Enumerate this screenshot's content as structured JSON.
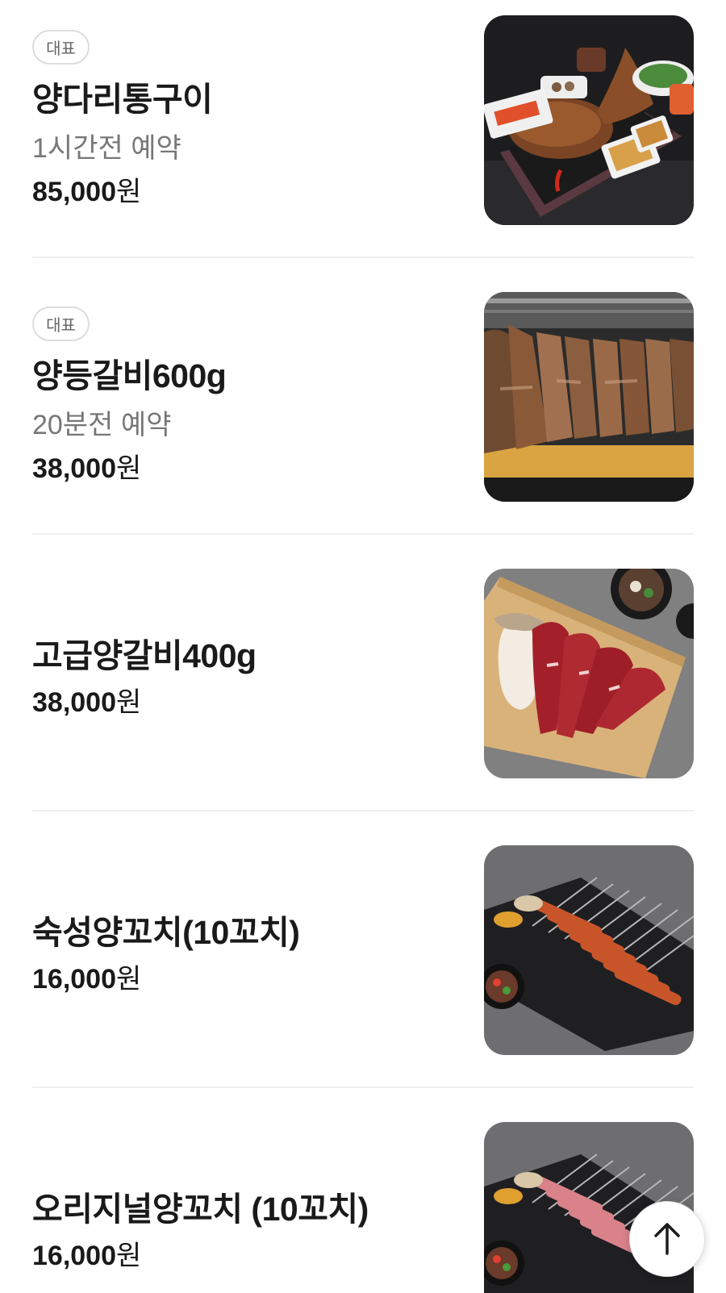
{
  "menu": {
    "items": [
      {
        "badge": "대표",
        "name": "양다리통구이",
        "note": "1시간전 예약",
        "price_num": "85,000",
        "price_unit": "원",
        "image_icon": "lamb-leg-roast-photo"
      },
      {
        "badge": "대표",
        "name": "양등갈비600g",
        "note": "20분전 예약",
        "price_num": "38,000",
        "price_unit": "원",
        "image_icon": "lamb-back-ribs-photo"
      },
      {
        "name": "고급양갈비400g",
        "price_num": "38,000",
        "price_unit": "원",
        "image_icon": "raw-lamb-ribs-photo"
      },
      {
        "name": "숙성양꼬치(10꼬치)",
        "price_num": "16,000",
        "price_unit": "원",
        "image_icon": "seasoned-lamb-skewers-photo"
      },
      {
        "name": "오리지널양꼬치 (10꼬치)",
        "price_num": "16,000",
        "price_unit": "원",
        "image_icon": "original-lamb-skewers-photo"
      }
    ]
  },
  "scroll_top": {
    "icon": "arrow-up-icon"
  },
  "colors": {
    "text": "#1a1a1a",
    "muted": "#777777",
    "divider": "#efefef",
    "badge_border": "#dddddd"
  }
}
